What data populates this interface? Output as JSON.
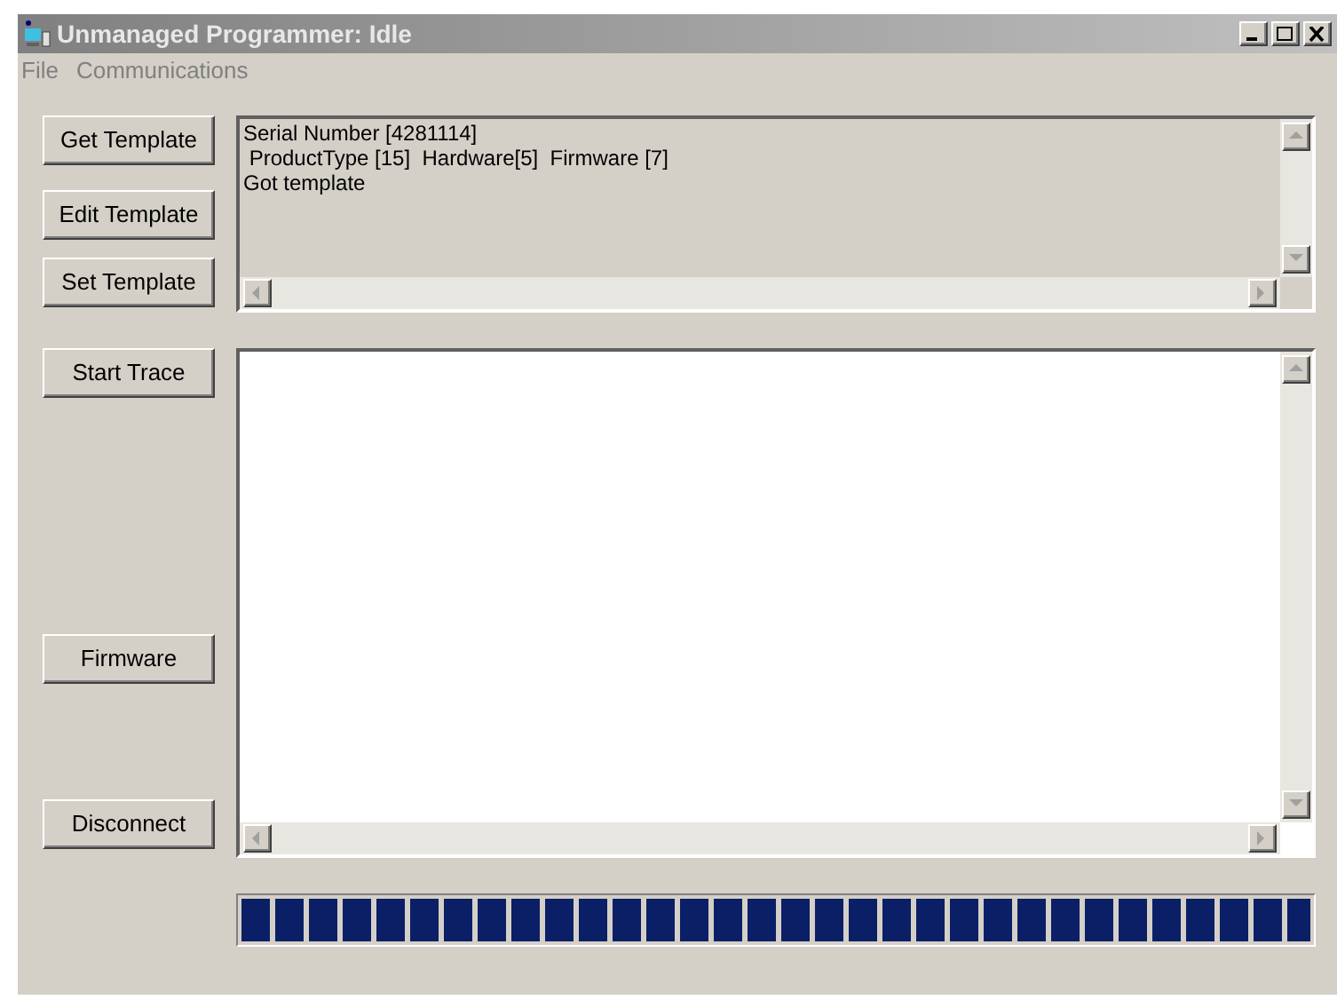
{
  "window": {
    "title": "Unmanaged Programmer: Idle",
    "active": false
  },
  "menu": [
    {
      "label": "File"
    },
    {
      "label": "Communications"
    }
  ],
  "template_buttons": [
    {
      "label": "Get Template"
    },
    {
      "label": "Edit Template"
    },
    {
      "label": "Set Template"
    }
  ],
  "template_log": [
    "Serial Number [4281114]",
    " ProductType [15]  Hardware[5]  Firmware [7]",
    "Got template"
  ],
  "trace_buttons": [
    {
      "label": "Start Trace"
    },
    {
      "label": "Firmware"
    },
    {
      "label": "Disconnect"
    }
  ],
  "progress": {
    "level": 1
  }
}
